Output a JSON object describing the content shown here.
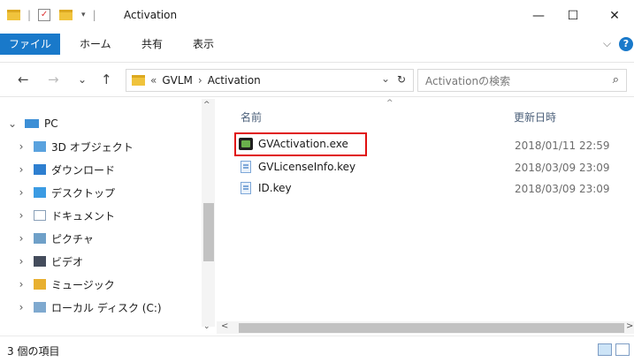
{
  "window": {
    "title": "Activation",
    "minimize_glyph": "—",
    "maximize_glyph": "☐",
    "close_glyph": "✕"
  },
  "ribbon": {
    "tabs": [
      "ファイル",
      "ホーム",
      "共有",
      "表示"
    ],
    "expand_glyph": "⌵",
    "help_glyph": "?"
  },
  "nav": {
    "back_glyph": "←",
    "forward_glyph": "→",
    "recent_glyph": "⌄",
    "up_glyph": "↑",
    "breadcrumb_overflow": "«",
    "breadcrumb": [
      "GVLM",
      "Activation"
    ],
    "breadcrumb_sep": "›",
    "address_dropdown_glyph": "⌄",
    "refresh_glyph": "↻",
    "search_placeholder": "Activationの検索",
    "search_glyph": "⌕"
  },
  "sidebar": {
    "items": [
      {
        "label": "PC",
        "chevron": "⌄",
        "icon": "pc-icon",
        "color": "#3d8fd6"
      },
      {
        "label": "3D オブジェクト",
        "chevron": "›",
        "icon": "3d-objects-icon",
        "color": "#5aa2de"
      },
      {
        "label": "ダウンロード",
        "chevron": "›",
        "icon": "download-icon",
        "color": "#2e7fd0"
      },
      {
        "label": "デスクトップ",
        "chevron": "›",
        "icon": "desktop-icon",
        "color": "#3b9be3"
      },
      {
        "label": "ドキュメント",
        "chevron": "›",
        "icon": "documents-icon",
        "color": "#8aa0b8"
      },
      {
        "label": "ピクチャ",
        "chevron": "›",
        "icon": "pictures-icon",
        "color": "#6fa0c8"
      },
      {
        "label": "ビデオ",
        "chevron": "›",
        "icon": "videos-icon",
        "color": "#444c5c"
      },
      {
        "label": "ミュージック",
        "chevron": "›",
        "icon": "music-icon",
        "color": "#e8b030"
      },
      {
        "label": "ローカル ディスク (C:)",
        "chevron": "›",
        "icon": "local-disk-icon",
        "color": "#7fa9cf"
      }
    ]
  },
  "content": {
    "columns": {
      "name": "名前",
      "modified": "更新日時"
    },
    "sort_glyph": "^",
    "files": [
      {
        "name": "GVActivation.exe",
        "date": "2018/01/11 22:59",
        "icon": "exe-icon"
      },
      {
        "name": "GVLicenseInfo.key",
        "date": "2018/03/09 23:09",
        "icon": "key-file-icon"
      },
      {
        "name": "ID.key",
        "date": "2018/03/09 23:09",
        "icon": "key-file-icon"
      }
    ],
    "highlight_color": "#e01010"
  },
  "scroll": {
    "up_glyph": "^",
    "down_glyph": "⌄",
    "left_glyph": "<",
    "right_glyph": ">"
  },
  "status": {
    "item_count": "3 個の項目"
  },
  "colors": {
    "accent": "#1979ca"
  }
}
